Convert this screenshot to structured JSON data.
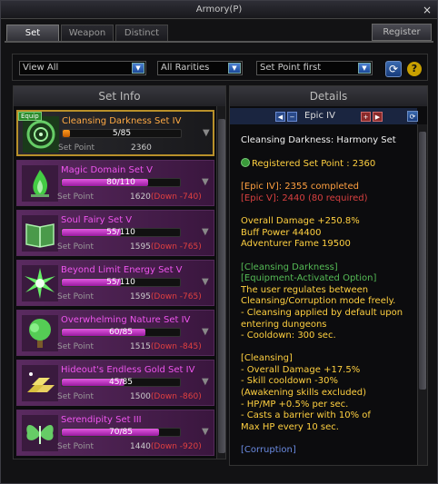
{
  "window": {
    "title": "Armory(P)",
    "close_glyph": "×"
  },
  "tabs": [
    {
      "label": "Set",
      "active": true
    },
    {
      "label": "Weapon",
      "active": false
    },
    {
      "label": "Distinct",
      "active": false
    }
  ],
  "register_button": "Register",
  "filters": {
    "view": "View All",
    "rarity": "All Rarities",
    "sort": "Set Point first",
    "arrow_glyph": "▼",
    "refresh_glyph": "⟳",
    "help_glyph": "?"
  },
  "set_info": {
    "header": "Set Info",
    "equip_badge": "Equip",
    "point_label": "Set Point",
    "items": [
      {
        "name": "Cleansing Darkness Set IV",
        "progress": "5/85",
        "fraction": 0.06,
        "points": "2360",
        "down": "",
        "icon": "spiral-emblem-icon",
        "selected": true
      },
      {
        "name": "Magic Domain Set V",
        "progress": "80/110",
        "fraction": 0.73,
        "points": "1620",
        "down": "(Down -740)",
        "icon": "green-flame-icon",
        "selected": false
      },
      {
        "name": "Soul Fairy Set V",
        "progress": "55/110",
        "fraction": 0.5,
        "points": "1595",
        "down": "(Down -765)",
        "icon": "open-book-icon",
        "selected": false
      },
      {
        "name": "Beyond Limit Energy Set V",
        "progress": "55/110",
        "fraction": 0.5,
        "points": "1595",
        "down": "(Down -765)",
        "icon": "energy-burst-icon",
        "selected": false
      },
      {
        "name": "Overwhelming Nature Set IV",
        "progress": "60/85",
        "fraction": 0.71,
        "points": "1515",
        "down": "(Down -845)",
        "icon": "tree-icon",
        "selected": false
      },
      {
        "name": "Hideout's Endless Gold Set IV",
        "progress": "45/85",
        "fraction": 0.53,
        "points": "1500",
        "down": "(Down -860)",
        "icon": "gold-bars-icon",
        "selected": false
      },
      {
        "name": "Serendipity Set III",
        "progress": "70/85",
        "fraction": 0.82,
        "points": "1440",
        "down": "(Down -920)",
        "icon": "butterfly-icon",
        "selected": false
      }
    ]
  },
  "details": {
    "header": "Details",
    "epic_label": "Epic IV",
    "set_title": "Cleansing Darkness: Harmony Set",
    "registered_point": "Registered Set Point : 2360",
    "epic4": "[Epic IV]: 2355 completed",
    "epic5": "[Epic V]: 2440 (80 required)",
    "stats": [
      "Overall Damage +250.8%",
      "Buff Power 44400",
      "Adventurer Fame 19500"
    ],
    "opt_name": "[Cleansing Darkness]",
    "opt_type": "[Equipment-Activated Option]",
    "opt_desc": [
      "The user regulates between",
      "Cleansing/Corruption mode freely.",
      "- Cleansing applied by default upon",
      "entering dungeons",
      "- Cooldown: 300 sec."
    ],
    "cleansing_head": "[Cleansing]",
    "cleansing": [
      "- Overall Damage +17.5%",
      "- Skill cooldown -30%",
      "(Awakening skills excluded)",
      "- HP/MP +0.5% per sec.",
      "- Casts a barrier with 10% of",
      "Max HP every 10 sec."
    ],
    "corruption_head": "[Corruption]"
  }
}
